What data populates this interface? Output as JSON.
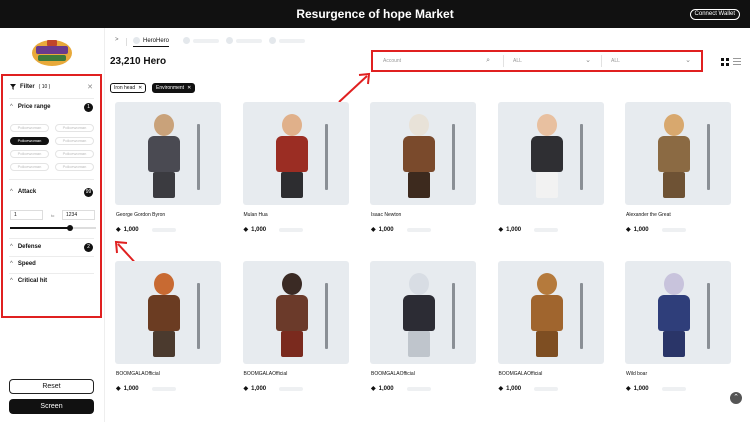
{
  "header": {
    "title": "Resurgence of hope Market",
    "wallet_button": "Connect Wallet"
  },
  "filter": {
    "title": "Filter",
    "count": "( 10 )",
    "sections": {
      "price_range": {
        "label": "Price range",
        "badge": "1"
      },
      "attack": {
        "label": "Attack",
        "badge": "99"
      },
      "defense": {
        "label": "Defense",
        "badge": "2"
      },
      "speed": {
        "label": "Speed"
      },
      "critical_hit": {
        "label": "Critical hit"
      }
    },
    "chips": [
      "Policewoman",
      "Policewoman",
      "Policewoman",
      "Policewoman",
      "Policewoman",
      "Policewoman",
      "Policewoman",
      "Policewoman"
    ],
    "active_chip_index": 2,
    "attack_range": {
      "min": "1",
      "to": "to",
      "max": "1234",
      "slider_fraction": 0.7
    },
    "reset_label": "Reset",
    "screen_label": "Screen"
  },
  "tabs": {
    "active": "HeroHero"
  },
  "main": {
    "count_title": "23,210 Hero"
  },
  "search": {
    "account_placeholder": "Account",
    "select1": "ALL",
    "select2": "ALL"
  },
  "tags": [
    {
      "label": "Iron head"
    },
    {
      "label": "Environment"
    }
  ],
  "cards": [
    {
      "name": "George Gordon Byron",
      "price": "1,000",
      "colors": [
        "#c9a27a",
        "#4a4a52",
        "#3b3b40"
      ]
    },
    {
      "name": "Mulan Hua",
      "price": "1,000",
      "colors": [
        "#e0b08a",
        "#9b2d23",
        "#2d2d30"
      ]
    },
    {
      "name": "Isaac Newton",
      "price": "1,000",
      "colors": [
        "#e8e2d8",
        "#7a4a2c",
        "#3d2a1e"
      ]
    },
    {
      "name": "",
      "price": "1,000",
      "colors": [
        "#e8c0a0",
        "#2f2f33",
        "#f2f2f2"
      ]
    },
    {
      "name": "Alexander the Great",
      "price": "1,000",
      "colors": [
        "#d8a86e",
        "#8b6a43",
        "#6e5234"
      ]
    },
    {
      "name": "BOOMGALAOfficial",
      "price": "1,000",
      "colors": [
        "#c86a32",
        "#6b3c22",
        "#4b3a2e"
      ]
    },
    {
      "name": "BOOMGALAOfficial",
      "price": "1,000",
      "colors": [
        "#3a2a24",
        "#6b3a2a",
        "#7a2a1e"
      ]
    },
    {
      "name": "BOOMGALAOfficial",
      "price": "1,000",
      "colors": [
        "#d8dde4",
        "#2c2c34",
        "#bfc5cc"
      ]
    },
    {
      "name": "BOOMGALAOfficial",
      "price": "1,000",
      "colors": [
        "#b57a3c",
        "#a0652e",
        "#7e4e22"
      ]
    },
    {
      "name": "Wild boar",
      "price": "1,000",
      "colors": [
        "#c8c3dc",
        "#2f3e7a",
        "#2a3568"
      ]
    }
  ]
}
